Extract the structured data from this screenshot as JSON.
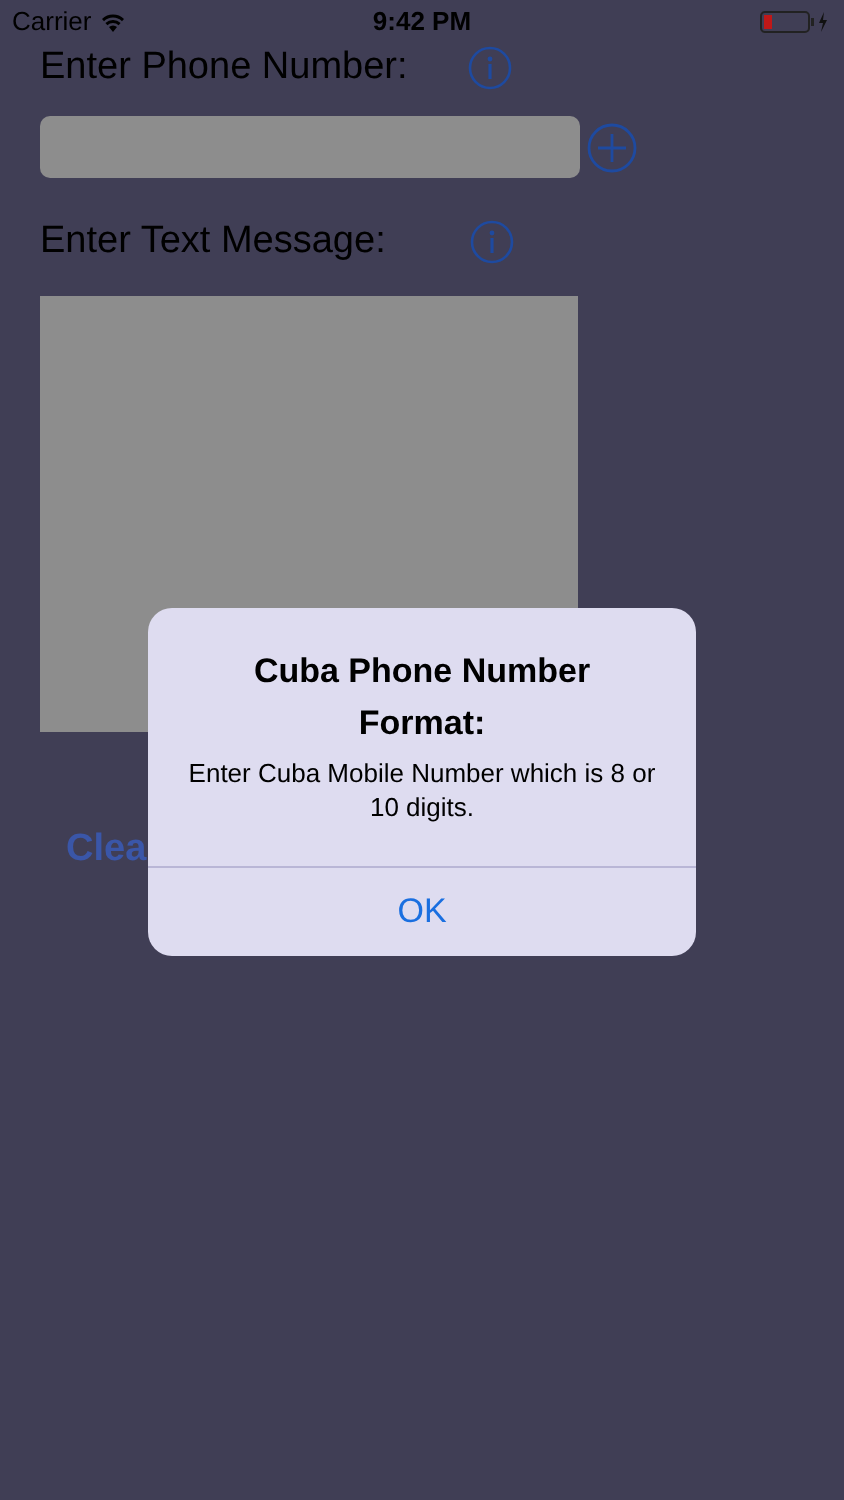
{
  "status_bar": {
    "carrier": "Carrier",
    "time": "9:42 PM"
  },
  "phone_label": "Enter Phone Number:",
  "message_label": "Enter Text Message:",
  "clear_button": "Clea",
  "alert": {
    "title": "Cuba Phone Number Format:",
    "message": "Enter Cuba Mobile Number which is 8 or 10 digits.",
    "button": "OK"
  }
}
